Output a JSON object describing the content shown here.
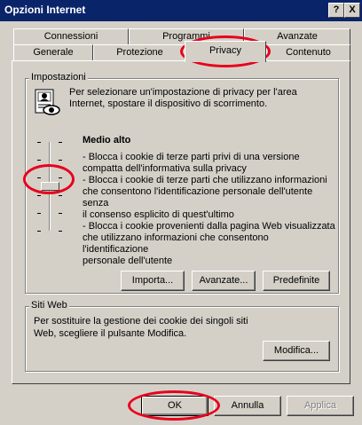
{
  "window": {
    "title": "Opzioni Internet",
    "help_button": "?",
    "close_button": "X"
  },
  "tabs": {
    "row_back": [
      "Connessioni",
      "Programmi",
      "Avanzate"
    ],
    "row_front": [
      "Generale",
      "Protezione",
      "Privacy",
      "Contenuto"
    ],
    "selected": "Privacy"
  },
  "settings_group": {
    "legend": "Impostazioni",
    "description": "Per selezionare un'impostazione di privacy per l'area Internet, spostare il dispositivo di scorrimento.",
    "level_title": "Medio alto",
    "level_lines": [
      "- Blocca i cookie di terze parti privi di una versione",
      "compatta dell'informativa sulla privacy",
      "- Blocca i cookie di terze parti che utilizzano informazioni",
      "che consentono l'identificazione personale dell'utente senza",
      "il consenso esplicito di quest'ultimo",
      "- Blocca i cookie provenienti dalla pagina Web visualizzata",
      "che utilizzano informazioni che consentono l'identificazione",
      "personale dell'utente"
    ],
    "slider_level": 3,
    "slider_levels_total": 6,
    "import_button": "Importa...",
    "advanced_button": "Avanzate...",
    "default_button": "Predefinite"
  },
  "websites_group": {
    "legend": "Siti Web",
    "description_lines": [
      "Per sostituire la gestione dei cookie dei singoli siti",
      "Web, scegliere il pulsante Modifica."
    ],
    "edit_button": "Modifica..."
  },
  "footer": {
    "ok_button": "OK",
    "cancel_button": "Annulla",
    "apply_button": "Applica"
  },
  "annotation_color": "#e8001c"
}
